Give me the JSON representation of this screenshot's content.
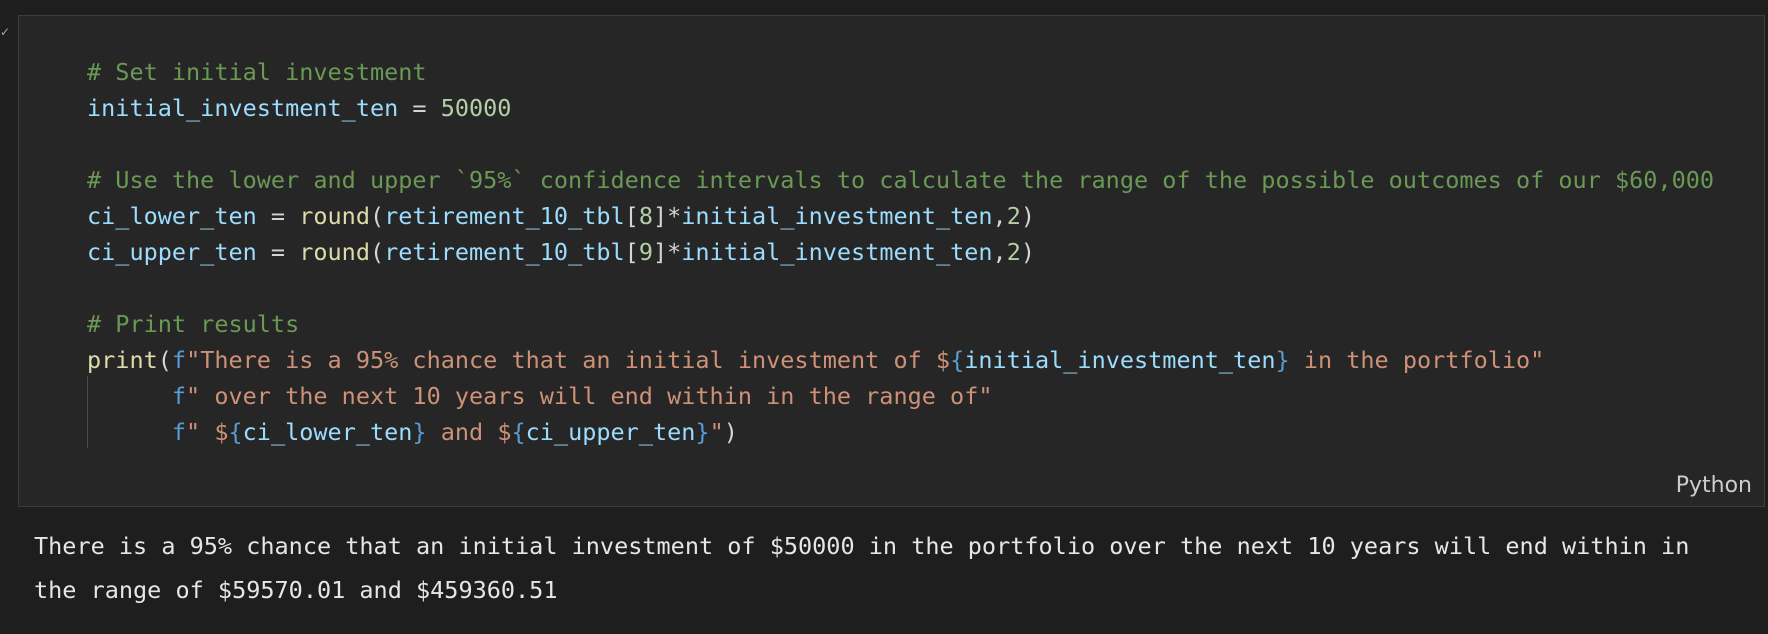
{
  "cell": {
    "status_icon": "check-icon",
    "status_glyph": "✓",
    "language_label": "Python",
    "code_lines": [
      [
        {
          "t": "cmt",
          "v": "# Set initial investment"
        }
      ],
      [
        {
          "t": "var",
          "v": "initial_investment_ten"
        },
        {
          "t": "op",
          "v": " = "
        },
        {
          "t": "num",
          "v": "50000"
        }
      ],
      [],
      [
        {
          "t": "cmt",
          "v": "# Use the lower and upper `95%` confidence intervals to calculate the range of the possible outcomes of our $60,000"
        }
      ],
      [
        {
          "t": "var",
          "v": "ci_lower_ten"
        },
        {
          "t": "op",
          "v": " = "
        },
        {
          "t": "fn",
          "v": "round"
        },
        {
          "t": "op",
          "v": "("
        },
        {
          "t": "var",
          "v": "retirement_10_tbl"
        },
        {
          "t": "op",
          "v": "["
        },
        {
          "t": "num",
          "v": "8"
        },
        {
          "t": "op",
          "v": "]*"
        },
        {
          "t": "var",
          "v": "initial_investment_ten"
        },
        {
          "t": "op",
          "v": ","
        },
        {
          "t": "num",
          "v": "2"
        },
        {
          "t": "op",
          "v": ")"
        }
      ],
      [
        {
          "t": "var",
          "v": "ci_upper_ten"
        },
        {
          "t": "op",
          "v": " = "
        },
        {
          "t": "fn",
          "v": "round"
        },
        {
          "t": "op",
          "v": "("
        },
        {
          "t": "var",
          "v": "retirement_10_tbl"
        },
        {
          "t": "op",
          "v": "["
        },
        {
          "t": "num",
          "v": "9"
        },
        {
          "t": "op",
          "v": "]*"
        },
        {
          "t": "var",
          "v": "initial_investment_ten"
        },
        {
          "t": "op",
          "v": ","
        },
        {
          "t": "num",
          "v": "2"
        },
        {
          "t": "op",
          "v": ")"
        }
      ],
      [],
      [
        {
          "t": "cmt",
          "v": "# Print results"
        }
      ],
      [
        {
          "t": "fn",
          "v": "print"
        },
        {
          "t": "op",
          "v": "("
        },
        {
          "t": "kw",
          "v": "f"
        },
        {
          "t": "str",
          "v": "\"There is a 95% chance that an initial investment of $"
        },
        {
          "t": "kw",
          "v": "{"
        },
        {
          "t": "var",
          "v": "initial_investment_ten"
        },
        {
          "t": "kw",
          "v": "}"
        },
        {
          "t": "str",
          "v": " in the portfolio\""
        }
      ],
      [
        {
          "t": "op",
          "v": "      "
        },
        {
          "t": "kw",
          "v": "f"
        },
        {
          "t": "str",
          "v": "\" over the next 10 years will end within in the range of\""
        }
      ],
      [
        {
          "t": "op",
          "v": "      "
        },
        {
          "t": "kw",
          "v": "f"
        },
        {
          "t": "str",
          "v": "\" $"
        },
        {
          "t": "kw",
          "v": "{"
        },
        {
          "t": "var",
          "v": "ci_lower_ten"
        },
        {
          "t": "kw",
          "v": "}"
        },
        {
          "t": "str",
          "v": " and $"
        },
        {
          "t": "kw",
          "v": "{"
        },
        {
          "t": "var",
          "v": "ci_upper_ten"
        },
        {
          "t": "kw",
          "v": "}"
        },
        {
          "t": "str",
          "v": "\""
        },
        {
          "t": "op",
          "v": ")"
        }
      ]
    ]
  },
  "output": {
    "text": "There is a 95% chance that an initial investment of $50000 in the portfolio over the next 10 years will end within in\nthe range of $59570.01 and $459360.51"
  }
}
